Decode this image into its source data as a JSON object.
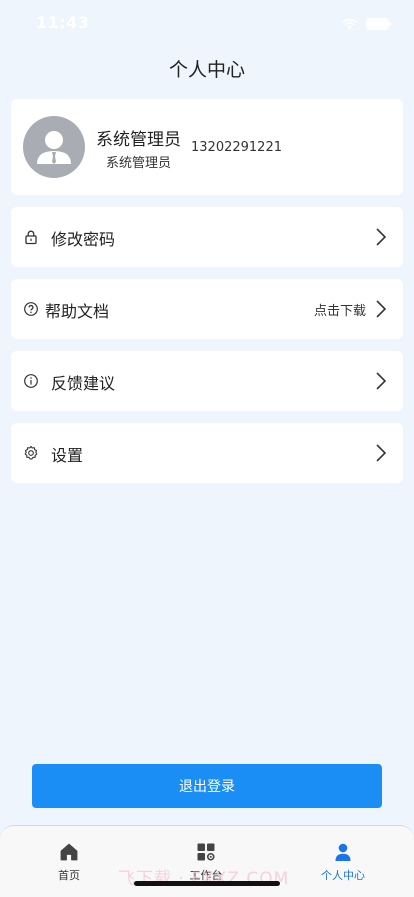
{
  "status_bar": {
    "time": "11:43"
  },
  "header": {
    "title": "个人中心"
  },
  "profile": {
    "name": "系统管理员",
    "role": "系统管理员",
    "phone": "13202291221"
  },
  "menu": {
    "change_password": {
      "label": "修改密码",
      "icon": "lock-icon"
    },
    "help_docs": {
      "label": "帮助文档",
      "extra": "点击下载",
      "icon": "help-circle-icon"
    },
    "feedback": {
      "label": "反馈建议",
      "icon": "info-circle-icon"
    },
    "settings": {
      "label": "设置",
      "icon": "gear-icon"
    }
  },
  "logout": {
    "label": "退出登录"
  },
  "tabbar": {
    "tabs": [
      {
        "label": "首页",
        "icon": "home-icon",
        "active": false
      },
      {
        "label": "工作台",
        "icon": "workbench-icon",
        "active": false
      },
      {
        "label": "个人中心",
        "icon": "person-icon",
        "active": true
      }
    ]
  },
  "watermark": {
    "text": "飞下载 · FXXZ.COM"
  },
  "colors": {
    "primary": "#1a8ef5",
    "active_tab": "#1a73e8",
    "background": "#eef5fd"
  }
}
